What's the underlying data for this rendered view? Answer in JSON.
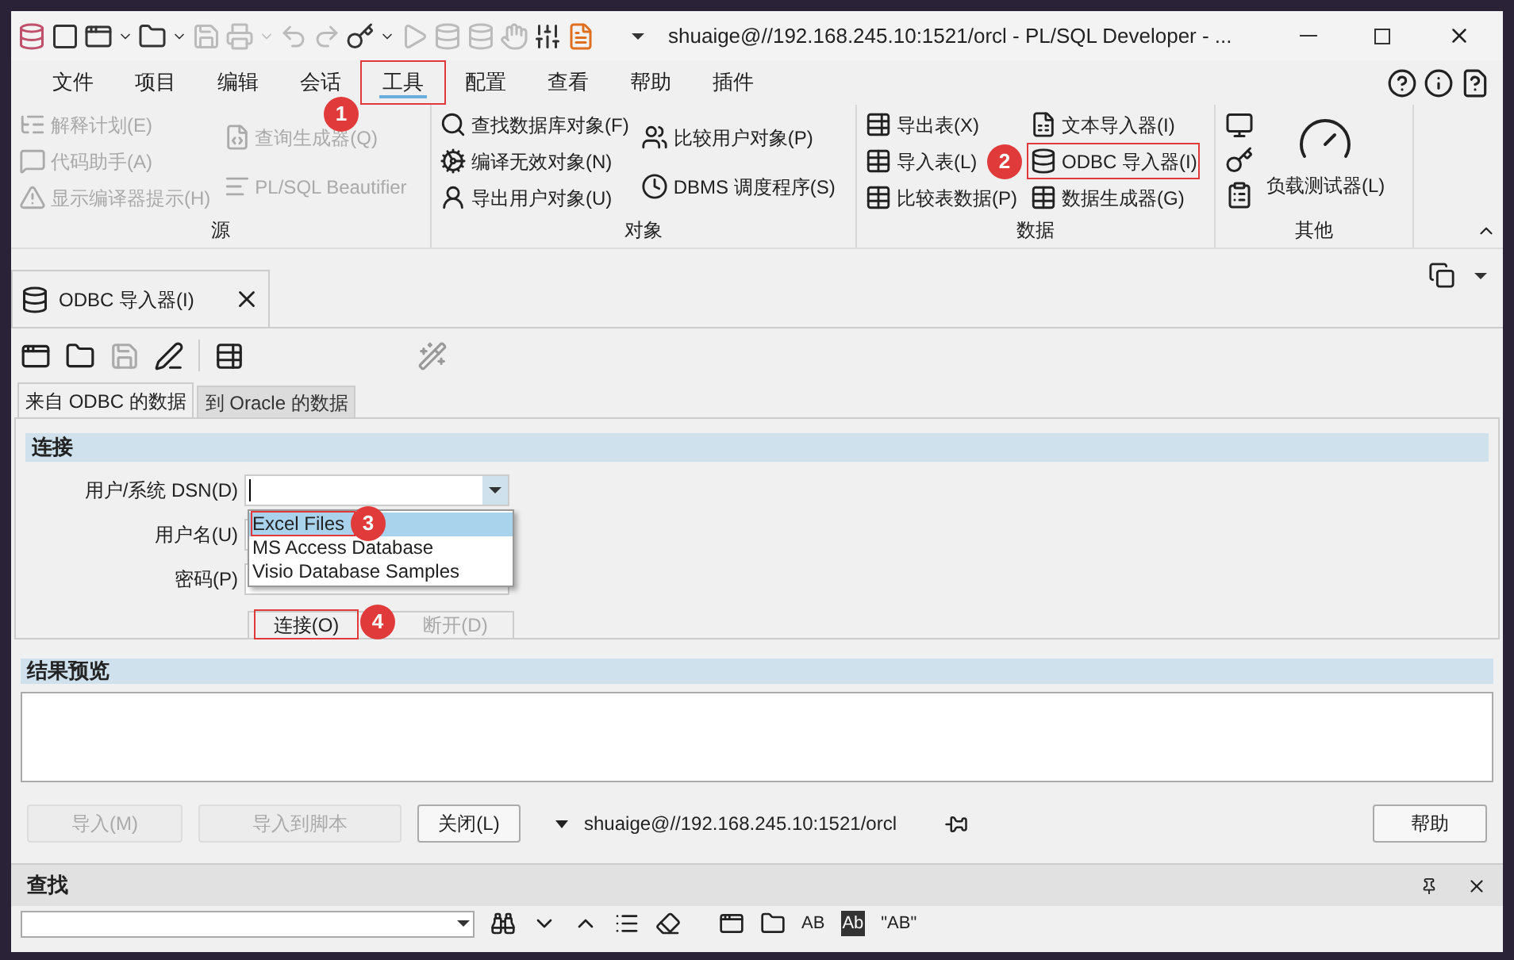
{
  "window": {
    "title": "shuaige@//192.168.245.10:1521/orcl - PL/SQL Developer - ..."
  },
  "menu": [
    {
      "label": "文件",
      "selected": false
    },
    {
      "label": "项目",
      "selected": false
    },
    {
      "label": "编辑",
      "selected": false
    },
    {
      "label": "会话",
      "selected": false
    },
    {
      "label": "工具",
      "selected": true,
      "badge": "1"
    },
    {
      "label": "配置",
      "selected": false
    },
    {
      "label": "查看",
      "selected": false
    },
    {
      "label": "帮助",
      "selected": false
    },
    {
      "label": "插件",
      "selected": false
    }
  ],
  "ribbon": [
    {
      "title": "源",
      "columns": [
        [
          {
            "label": "解释计划(E)",
            "disabled": true
          },
          {
            "label": "代码助手(A)",
            "disabled": true
          },
          {
            "label": "显示编译器提示(H)",
            "disabled": true
          }
        ],
        [
          {
            "label": "查询生成器(Q)",
            "disabled": true
          },
          {
            "label": "PL/SQL Beautifier",
            "disabled": true
          }
        ]
      ]
    },
    {
      "title": "对象",
      "columns": [
        [
          {
            "label": "查找数据库对象(F)",
            "disabled": false
          },
          {
            "label": "编译无效对象(N)",
            "disabled": false
          },
          {
            "label": "导出用户对象(U)",
            "disabled": false
          }
        ],
        [
          {
            "label": "比较用户对象(P)",
            "disabled": false
          },
          {
            "label": "DBMS 调度程序(S)",
            "disabled": false
          }
        ]
      ]
    },
    {
      "title": "数据",
      "columns": [
        [
          {
            "label": "导出表(X)",
            "disabled": false
          },
          {
            "label": "导入表(L)",
            "disabled": false
          },
          {
            "label": "比较表数据(P)",
            "disabled": false
          }
        ],
        [
          {
            "label": "文本导入器(I)",
            "disabled": false
          },
          {
            "label": "ODBC 导入器(I)",
            "disabled": false,
            "badge": "2"
          },
          {
            "label": "数据生成器(G)",
            "disabled": false
          }
        ]
      ]
    },
    {
      "title": "其他",
      "large": {
        "label": "负载测试器(L)"
      }
    }
  ],
  "document_tab": {
    "label": "ODBC 导入器(I)"
  },
  "subtabs": [
    {
      "label": "来自 ODBC 的数据",
      "selected": true
    },
    {
      "label": "到 Oracle 的数据",
      "selected": false
    }
  ],
  "connect_section": {
    "title": "连接",
    "fields": [
      {
        "label": "用户/系统 DSN(D)",
        "kind": "combo"
      },
      {
        "label": "用户名(U)",
        "kind": "text"
      },
      {
        "label": "密码(P)",
        "kind": "text"
      }
    ],
    "dropdown": [
      {
        "label": "Excel Files",
        "selected": true,
        "badge": "3"
      },
      {
        "label": "MS Access Database",
        "selected": false
      },
      {
        "label": "Visio Database Samples",
        "selected": false
      }
    ],
    "buttons": [
      {
        "label": "连接(O)",
        "disabled": false,
        "badge": "4"
      },
      {
        "label": "断开(D)",
        "disabled": true
      }
    ]
  },
  "preview_section": {
    "title": "结果预览"
  },
  "bottom_bar": {
    "buttons": [
      {
        "label": "导入(M)",
        "disabled": true
      },
      {
        "label": "导入到脚本",
        "disabled": true
      },
      {
        "label": "关闭(L)",
        "disabled": false
      }
    ],
    "connection": "shuaige@//192.168.245.10:1521/orcl",
    "help": "帮助"
  },
  "find_panel": {
    "title": "查找",
    "toolbar_texts": [
      "AB",
      "Ab",
      "\"AB\""
    ]
  }
}
